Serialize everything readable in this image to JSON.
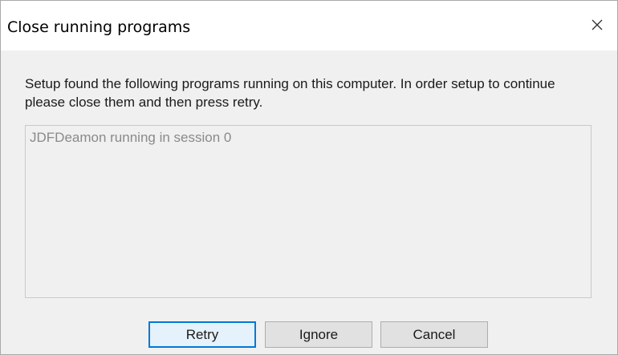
{
  "window": {
    "title": "Close running programs",
    "close_icon": "close-icon"
  },
  "message": "Setup found the following programs running on this computer. In order setup to continue please close them and then press retry.",
  "programs": [
    "JDFDeamon running in session 0"
  ],
  "buttons": {
    "retry": "Retry",
    "ignore": "Ignore",
    "cancel": "Cancel"
  },
  "colors": {
    "accent": "#0078d7",
    "dialog_bg": "#f0f0f0",
    "titlebar_bg": "#ffffff",
    "disabled_text": "#8a8a8a"
  }
}
